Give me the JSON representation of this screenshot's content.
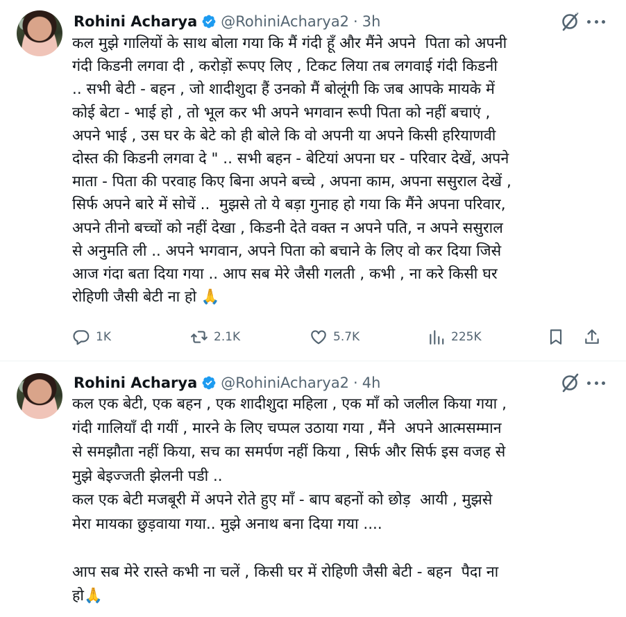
{
  "tweets": [
    {
      "author_name": "Rohini Acharya",
      "handle": "@RohiniAcharya2",
      "separator": "·",
      "time": "3h",
      "text": "कल मुझे गालियों के साथ बोला गया कि मैं गंदी हूँ और मैंने अपने  पिता को अपनी\nगंदी किडनी लगवा दी , करोड़ों रूपए लिए , टिकट लिया तब लगवाई गंदी किडनी\n.. सभी बेटी - बहन , जो शादीशुदा हैं उनको मैं बोलूंगी कि जब आपके मायके में\nकोई बेटा - भाई हो , तो भूल कर भी अपने भगवान रूपी पिता को नहीं बचाएं ,\nअपने भाई , उस घर के बेटे को ही बोले कि वो अपनी या अपने किसी हरियाणवी\nदोस्त की किडनी लगवा दे \" .. सभी बहन - बेटियां अपना घर - परिवार देखें, अपने\nमाता - पिता की परवाह किए बिना अपने बच्चे , अपना काम, अपना ससुराल देखें ,\nसिर्फ अपने बारे में सोचें ..  मुझसे तो ये बड़ा गुनाह हो गया कि मैंने अपना परिवार,\nअपने तीनो बच्चों को नहीं देखा , किडनी देते वक्त न अपने पति, न अपने ससुराल\nसे अनुमति ली .. अपने भगवान, अपने पिता को बचाने के लिए वो कर दिया जिसे\nआज गंदा बता दिया गया .. आप सब मेरे जैसी गलती , कभी , ना करे किसी घर\nरोहिणी जैसी बेटी ना हो 🙏",
      "replies": "1K",
      "reposts": "2.1K",
      "likes": "5.7K",
      "views": "225K"
    },
    {
      "author_name": "Rohini Acharya",
      "handle": "@RohiniAcharya2",
      "separator": "·",
      "time": "4h",
      "text": "कल एक बेटी, एक बहन , एक शादीशुदा महिला , एक माँ को जलील किया गया ,\nगंदी गालियाँ दी गयीं , मारने के लिए चप्पल उठाया गया , मैंने  अपने आत्मसम्मान\nसे समझौता नहीं किया, सच का समर्पण नहीं किया , सिर्फ और सिर्फ इस वजह से\nमुझे बेइज्जती झेलनी पडी ..\nकल एक बेटी मजबूरी में अपने रोते हुए माँ - बाप बहनों को छोड़  आयी , मुझसे\nमेरा मायका छुड़वाया गया.. मुझे अनाथ बना दिया गया ....\n\nआप सब मेरे रास्ते कभी ना चलें , किसी घर में रोहिणी जैसी बेटी - बहन  पैदा ना\nहो🙏"
    }
  ],
  "colors": {
    "verified": "#1d9bf0",
    "text": "#0f1419",
    "secondary": "#536471",
    "divider": "#eff3f4"
  },
  "icons": [
    "verified-badge-icon",
    "grok-icon",
    "more-icon",
    "reply-icon",
    "repost-icon",
    "like-icon",
    "views-icon",
    "bookmark-icon",
    "share-icon"
  ]
}
